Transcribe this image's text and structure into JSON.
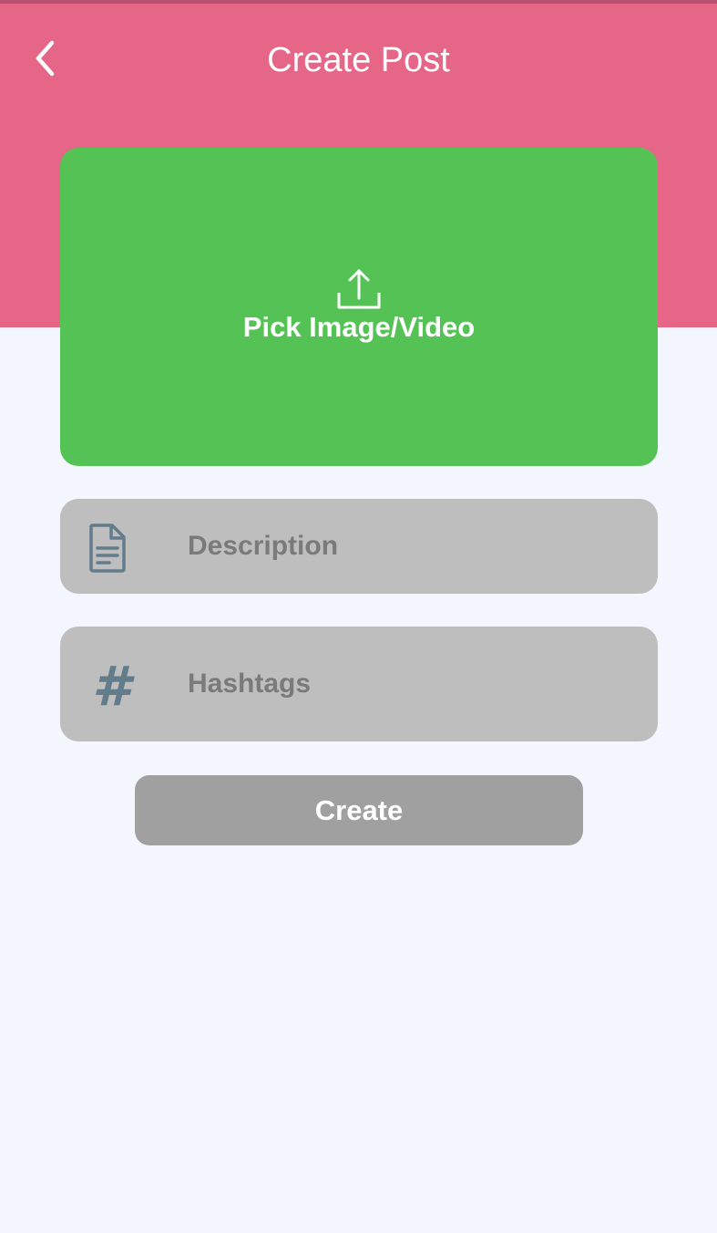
{
  "header": {
    "title": "Create Post",
    "back_icon": "chevron-left-icon",
    "background": "#e66688"
  },
  "media_picker": {
    "label": "Pick Image/Video",
    "icon": "upload-icon",
    "background": "#55c255"
  },
  "form": {
    "description": {
      "placeholder": "Description",
      "icon": "document-icon"
    },
    "hashtags": {
      "placeholder": "Hashtags",
      "icon": "hashtag-icon",
      "glyph": "#"
    }
  },
  "actions": {
    "create_label": "Create",
    "create_background": "#a0a0a0"
  }
}
